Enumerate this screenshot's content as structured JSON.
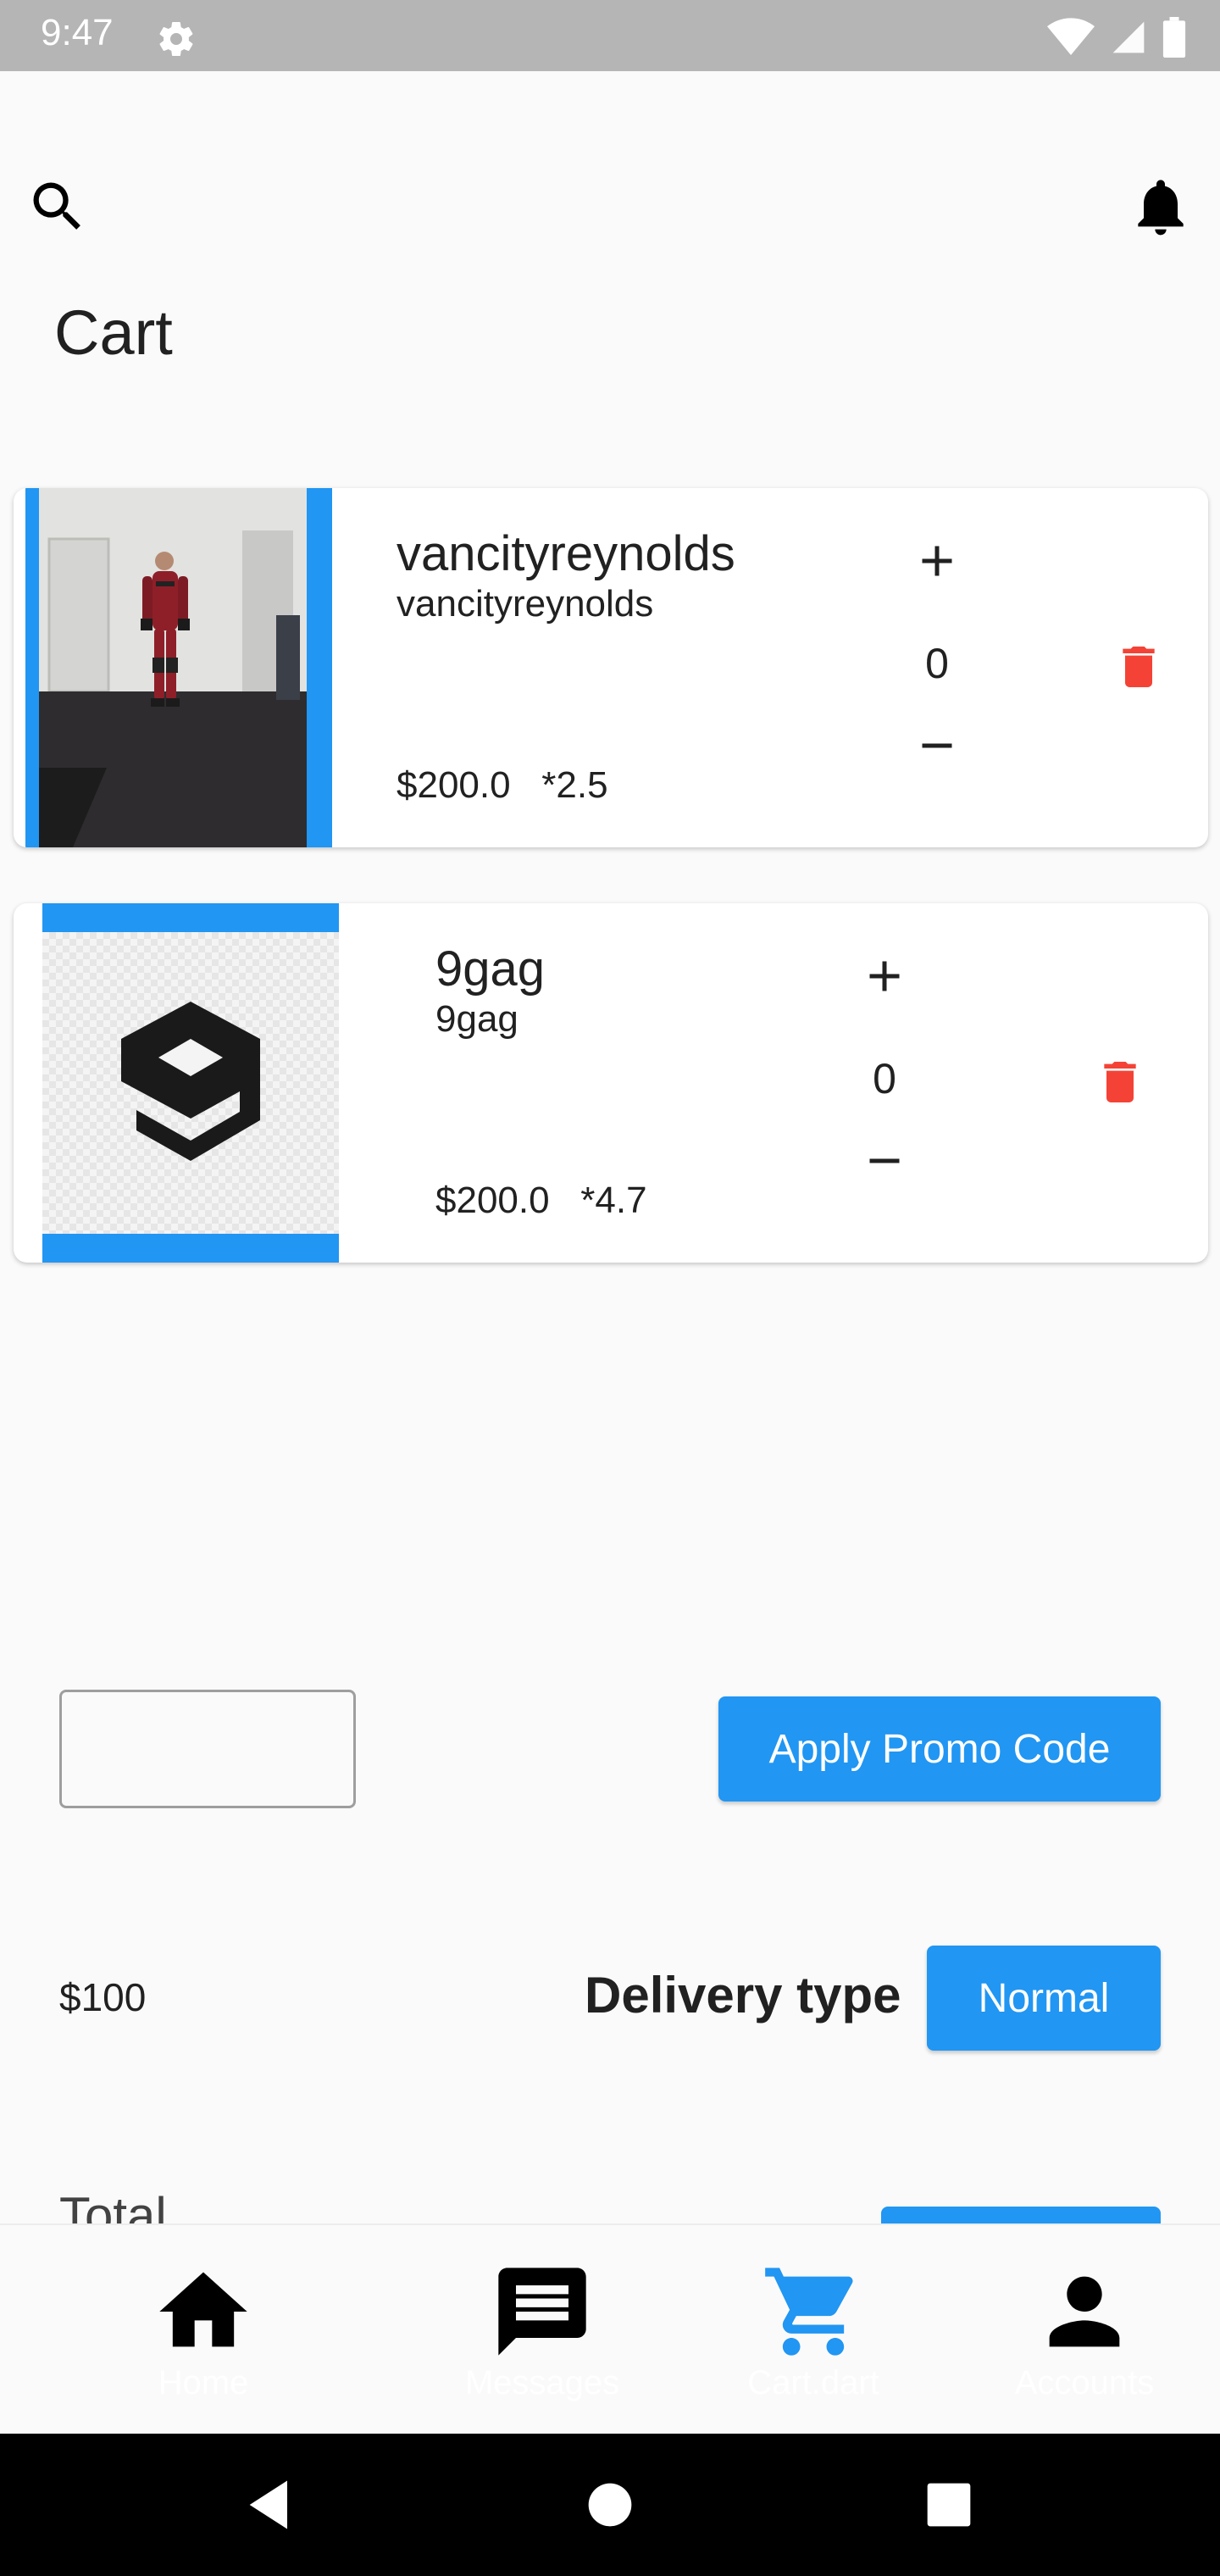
{
  "status_bar": {
    "time": "9:47"
  },
  "page": {
    "title": "Cart"
  },
  "cart_items": [
    {
      "name": "vancityreynolds",
      "subtitle": "vancityreynolds",
      "price": "$200.0",
      "multiplier": "*2.5",
      "quantity": "0"
    },
    {
      "name": "9gag",
      "subtitle": "9gag",
      "price": "$200.0",
      "multiplier": "*4.7",
      "quantity": "0"
    }
  ],
  "promo": {
    "input_value": "",
    "button_label": "Apply Promo Code"
  },
  "delivery": {
    "price": "$100",
    "label": "Delivery type",
    "button_label": "Normal"
  },
  "total": {
    "label": "Total"
  },
  "bottom_nav": [
    {
      "label": "Home",
      "icon": "home-icon"
    },
    {
      "label": "Messages",
      "icon": "message-icon"
    },
    {
      "label": "Cart.dart",
      "icon": "cart-icon"
    },
    {
      "label": "Accounts",
      "icon": "person-icon"
    }
  ],
  "colors": {
    "accent": "#2196f3",
    "delete": "#f44336",
    "nav_active": "#2196f3",
    "nav_inactive": "#000000"
  }
}
